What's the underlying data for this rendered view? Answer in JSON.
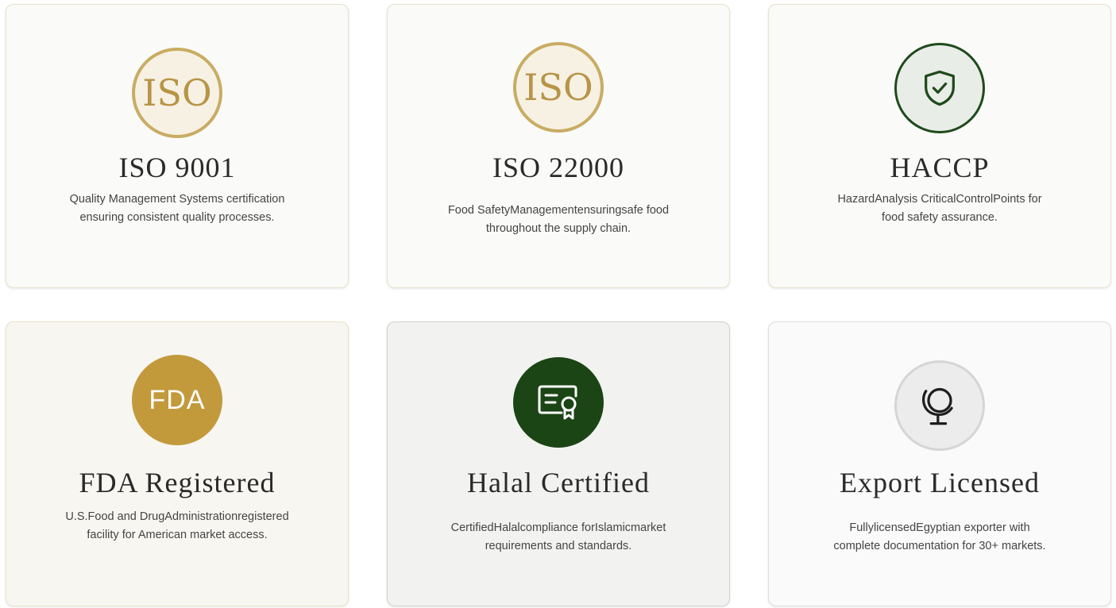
{
  "certifications": [
    {
      "badge_text": "ISO",
      "title": "ISO 9001",
      "desc_line1": "Quality Management Systems certification",
      "desc_line2": "ensuring consistent quality processes."
    },
    {
      "badge_text": "ISO",
      "title": "ISO 22000",
      "desc_line1": "Food SafetyManagementensuringsafe food",
      "desc_line2": "throughout the supply chain."
    },
    {
      "icon": "shield-check-icon",
      "title": "HACCP",
      "desc_line1": "HazardAnalysis CriticalControlPoints for",
      "desc_line2": "food safety assurance."
    },
    {
      "badge_text": "FDA",
      "title": "FDA Registered",
      "desc_line1": "U.S.Food and DrugAdministrationregistered",
      "desc_line2": "facility for American market access."
    },
    {
      "icon": "certificate-icon",
      "title": "Halal Certified",
      "desc_line1": "CertifiedHalalcompliance forIslamicmarket",
      "desc_line2": "requirements and standards."
    },
    {
      "icon": "globe-icon",
      "title": "Export Licensed",
      "desc_line1": "FullylicensedEgyptian exporter with",
      "desc_line2": "complete documentation for 30+ markets."
    }
  ],
  "colors": {
    "gold": "#c29a3c",
    "dark_green": "#1b4514",
    "text": "#2a2a2a"
  }
}
